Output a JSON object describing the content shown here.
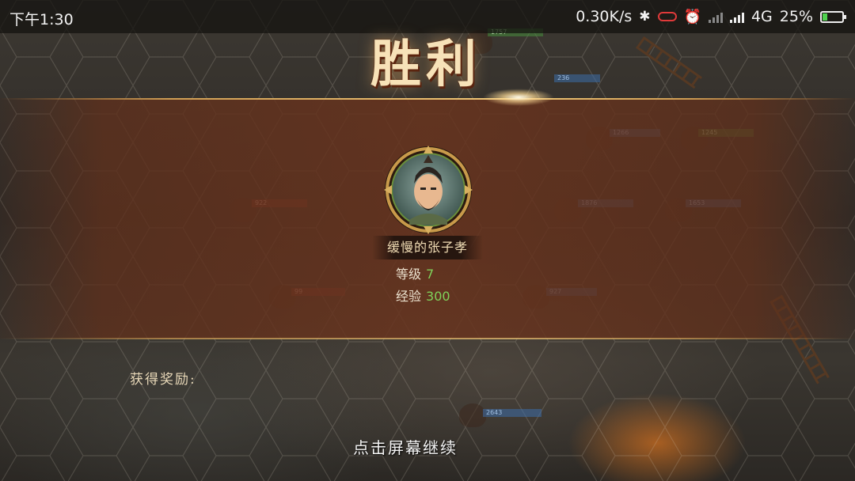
{
  "statusbar": {
    "time": "下午1:30",
    "net_speed": "0.30K/s",
    "network": "4G",
    "battery_percent": "25%",
    "battery_level": 0.25
  },
  "victory": {
    "title": "胜利"
  },
  "hero": {
    "name": "缓慢的张子孝",
    "level_label": "等级",
    "level_value": "7",
    "exp_label": "经验",
    "exp_value": "300"
  },
  "rewards": {
    "label": "获得奖励:"
  },
  "continue_hint": "点击屏幕继续",
  "battlefield": {
    "hp_labels": [
      "1757",
      "236",
      "1266",
      "1245",
      "922",
      "1876",
      "1653",
      "99",
      "927",
      "2643"
    ]
  },
  "colors": {
    "panel": "#69341e",
    "title": "#f7e2b8",
    "stat_value": "#7fd25a"
  }
}
